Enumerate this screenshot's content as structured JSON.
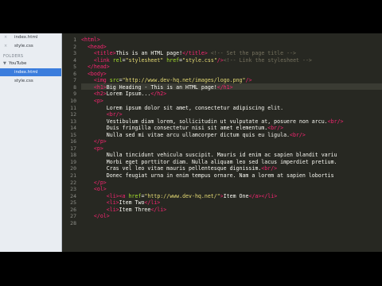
{
  "sidebar": {
    "open_files": [
      {
        "name": "index.html",
        "selected": false
      },
      {
        "name": "style.css",
        "selected": false
      }
    ],
    "folders_label": "FOLDERS",
    "folder_name": "YouTube",
    "files": [
      {
        "name": "index.html",
        "selected": true
      },
      {
        "name": "style.css",
        "selected": false
      }
    ]
  },
  "lines": [
    {
      "n": "1",
      "segs": [
        [
          "tg",
          "<html>"
        ]
      ]
    },
    {
      "n": "2",
      "segs": [
        [
          "",
          "  "
        ],
        [
          "tg",
          "<head>"
        ]
      ]
    },
    {
      "n": "3",
      "segs": [
        [
          "",
          "    "
        ],
        [
          "tg",
          "<title>"
        ],
        [
          "",
          "This is an HTML page!"
        ],
        [
          "tg",
          "</title>"
        ],
        [
          "",
          " "
        ],
        [
          "cm",
          "<!-- Set the page title -->"
        ]
      ]
    },
    {
      "n": "4",
      "segs": [
        [
          "",
          "    "
        ],
        [
          "tg",
          "<link "
        ],
        [
          "at",
          "rel"
        ],
        [
          "",
          "="
        ],
        [
          "st",
          "\"stylesheet\""
        ],
        [
          "",
          " "
        ],
        [
          "at",
          "href"
        ],
        [
          "",
          "="
        ],
        [
          "st",
          "\"style.css\""
        ],
        [
          "tg",
          "/>"
        ],
        [
          "cm",
          "<!-- Link the stylesheet -->"
        ]
      ]
    },
    {
      "n": "5",
      "segs": [
        [
          "",
          "  "
        ],
        [
          "tg",
          "</head>"
        ]
      ]
    },
    {
      "n": "6",
      "segs": [
        [
          "",
          "  "
        ],
        [
          "tg",
          "<body>"
        ]
      ]
    },
    {
      "n": "7",
      "segs": [
        [
          "",
          "    "
        ],
        [
          "tg",
          "<img "
        ],
        [
          "at",
          "src"
        ],
        [
          "",
          "="
        ],
        [
          "st",
          "\"http://www.dev-hq.net/images/logo.png\""
        ],
        [
          "tg",
          "/>"
        ]
      ]
    },
    {
      "n": "8",
      "segs": [
        [
          "",
          "    "
        ],
        [
          "tg",
          "<h1>"
        ],
        [
          "",
          "Big Heading - This is an HTML page!"
        ],
        [
          "tg",
          "</h1>"
        ]
      ]
    },
    {
      "n": "9",
      "segs": [
        [
          "",
          "    "
        ],
        [
          "tg",
          "<h2>"
        ],
        [
          "",
          "Lorem Ipsum..."
        ],
        [
          "tg",
          "</h2>"
        ]
      ]
    },
    {
      "n": "10",
      "segs": [
        [
          "",
          "    "
        ],
        [
          "tg",
          "<p>"
        ]
      ]
    },
    {
      "n": "11",
      "segs": [
        [
          "",
          "        Lorem ipsum dolor sit amet, consectetur adipiscing elit."
        ]
      ]
    },
    {
      "n": "12",
      "segs": [
        [
          "",
          "        "
        ],
        [
          "tg",
          "<br/>"
        ]
      ]
    },
    {
      "n": "13",
      "segs": [
        [
          "",
          "        Vestibulum diam lorem, sollicitudin ut vulputate at, posuere non arcu."
        ],
        [
          "tg",
          "<br/>"
        ]
      ]
    },
    {
      "n": "14",
      "segs": [
        [
          "",
          "        Duis fringilla consectetur nisi sit amet elementum."
        ],
        [
          "tg",
          "<br/>"
        ]
      ]
    },
    {
      "n": "15",
      "segs": [
        [
          "",
          "        Nulla sed mi vitae arcu ullamcorper dictum quis eu ligula."
        ],
        [
          "tg",
          "<br/>"
        ]
      ]
    },
    {
      "n": "16",
      "segs": [
        [
          "",
          "    "
        ],
        [
          "tg",
          "</p>"
        ]
      ]
    },
    {
      "n": "17",
      "segs": [
        [
          "",
          "    "
        ],
        [
          "tg",
          "<p>"
        ]
      ]
    },
    {
      "n": "18",
      "segs": [
        [
          "",
          "        Nulla tincidunt vehicula suscipit. Mauris id enim ac sapien blandit variu"
        ]
      ]
    },
    {
      "n": "19",
      "segs": [
        [
          "",
          "        Morbi eget porttitor diam. Nulla aliquam leo sed lacus imperdiet pretium."
        ]
      ]
    },
    {
      "n": "20",
      "segs": [
        [
          "",
          "        Cras vel leo vitae mauris pellentesque dignissim."
        ],
        [
          "tg",
          "<br/>"
        ]
      ]
    },
    {
      "n": "21",
      "segs": [
        [
          "",
          "        Donec feugiat urna in enim tempus ornare. Nam a lorem at sapien lobortis"
        ]
      ]
    },
    {
      "n": "22",
      "segs": [
        [
          "",
          "    "
        ],
        [
          "tg",
          "</p>"
        ]
      ]
    },
    {
      "n": "23",
      "segs": [
        [
          "",
          "    "
        ],
        [
          "tg",
          "<ol>"
        ]
      ]
    },
    {
      "n": "24",
      "segs": [
        [
          "",
          "        "
        ],
        [
          "tg",
          "<li><a "
        ],
        [
          "at",
          "href"
        ],
        [
          "",
          "="
        ],
        [
          "st",
          "\"http://www.dev-hq.net/\""
        ],
        [
          "tg",
          ">"
        ],
        [
          "",
          "Item One"
        ],
        [
          "tg",
          "</a></li>"
        ]
      ]
    },
    {
      "n": "25",
      "segs": [
        [
          "",
          "        "
        ],
        [
          "tg",
          "<li>"
        ],
        [
          "",
          "Item Two"
        ],
        [
          "tg",
          "</li>"
        ]
      ]
    },
    {
      "n": "26",
      "segs": [
        [
          "",
          "        "
        ],
        [
          "tg",
          "<li>"
        ],
        [
          "",
          "Item Three"
        ],
        [
          "tg",
          "</li>"
        ]
      ]
    },
    {
      "n": "27",
      "segs": [
        [
          "",
          "    "
        ],
        [
          "tg",
          "</ol>"
        ]
      ]
    },
    {
      "n": "28",
      "segs": [
        [
          "",
          "    "
        ]
      ]
    }
  ],
  "current_line": "8"
}
